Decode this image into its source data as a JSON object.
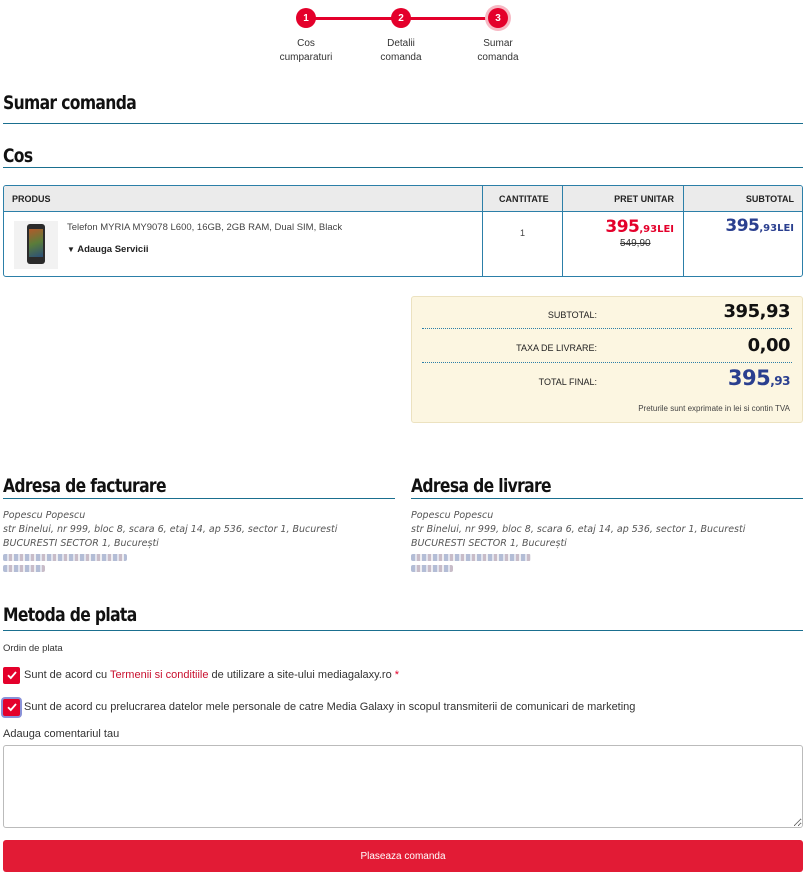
{
  "stepper": {
    "steps": [
      {
        "number": "1",
        "label_line1": "Cos",
        "label_line2": "cumparaturi"
      },
      {
        "number": "2",
        "label_line1": "Detalii",
        "label_line2": "comanda"
      },
      {
        "number": "3",
        "label_line1": "Sumar",
        "label_line2": "comanda"
      }
    ],
    "active_step": 3
  },
  "page_title": "Sumar comanda",
  "cart_title": "Cos",
  "cart": {
    "headers": {
      "product": "PRODUS",
      "quantity": "CANTITATE",
      "unit_price": "PRET UNITAR",
      "subtotal": "SUBTOTAL"
    },
    "items": [
      {
        "name": "Telefon MYRIA MY9078 L600, 16GB, 2GB RAM, Dual SIM, Black",
        "services_label": "Adauga Servicii",
        "quantity": "1",
        "unit_price_int": "395",
        "unit_price_dec": ",93LEI",
        "old_price": "549,90",
        "subtotal_int": "395",
        "subtotal_dec": ",93LEI"
      }
    ]
  },
  "totals": {
    "subtotal_label": "SUBTOTAL:",
    "subtotal_value": "395,93",
    "shipping_label": "TAXA DE LIVRARE:",
    "shipping_value": "0,00",
    "final_label": "TOTAL FINAL:",
    "final_int": "395",
    "final_dec": ",93",
    "note": "Preturile sunt exprimate in lei si contin TVA"
  },
  "billing": {
    "title": "Adresa de facturare",
    "name": "Popescu Popescu",
    "street": "str Binelui, nr 999, bloc 8, scara 6, etaj 14, ap 536, sector 1, Bucuresti",
    "city": "BUCURESTI SECTOR 1, București"
  },
  "shipping": {
    "title": "Adresa de livrare",
    "name": "Popescu Popescu",
    "street": "str Binelui, nr 999, bloc 8, scara 6, etaj 14, ap 536, sector 1, Bucuresti",
    "city": "BUCURESTI SECTOR 1, București"
  },
  "payment": {
    "title": "Metoda de plata",
    "method": "Ordin de plata",
    "terms_prefix": "Sunt de acord cu ",
    "terms_link": "Termenii si conditiile",
    "terms_suffix": " de utilizare a site-ului mediagalaxy.ro ",
    "terms_required": "*",
    "marketing_text": "Sunt de acord cu prelucrarea datelor mele personale de catre Media Galaxy in scopul transmiterii de comunicari de marketing",
    "comment_label": "Adauga comentariul tau",
    "comment_value": "",
    "submit_label": "Plaseaza comanda"
  },
  "colors": {
    "accent": "#e4002b",
    "price_blue": "#2a3f8f",
    "rule": "#1a6f8f",
    "totals_bg": "#fcf6e1"
  }
}
